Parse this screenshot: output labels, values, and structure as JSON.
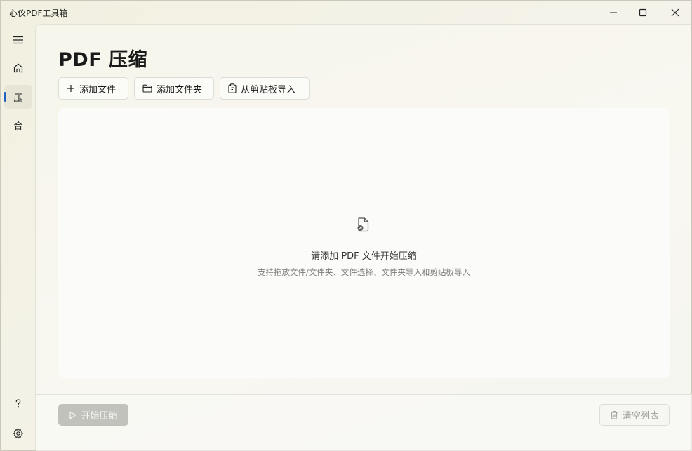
{
  "window": {
    "title": "心仪PDF工具箱"
  },
  "sidebar": {
    "items": [
      {
        "name": "menu",
        "icon": "hamburger-menu-icon"
      },
      {
        "name": "home",
        "icon": "home-icon"
      },
      {
        "name": "compress",
        "label": "压",
        "active": true
      },
      {
        "name": "merge",
        "label": "合"
      },
      {
        "name": "help",
        "icon": "help-icon"
      },
      {
        "name": "settings",
        "icon": "gear-icon"
      }
    ]
  },
  "main": {
    "title": "PDF 压缩",
    "toolbar": {
      "add_file": "添加文件",
      "add_folder": "添加文件夹",
      "import_clipboard": "从剪贴板导入"
    },
    "dropzone": {
      "title": "请添加 PDF 文件开始压缩",
      "subtitle": "支持拖放文件/文件夹、文件选择、文件夹导入和剪贴板导入"
    },
    "footer": {
      "start": "开始压缩",
      "clear": "清空列表"
    }
  },
  "colors": {
    "accent": "#1f5fbf",
    "disabled_button": "#c2c2bd"
  }
}
